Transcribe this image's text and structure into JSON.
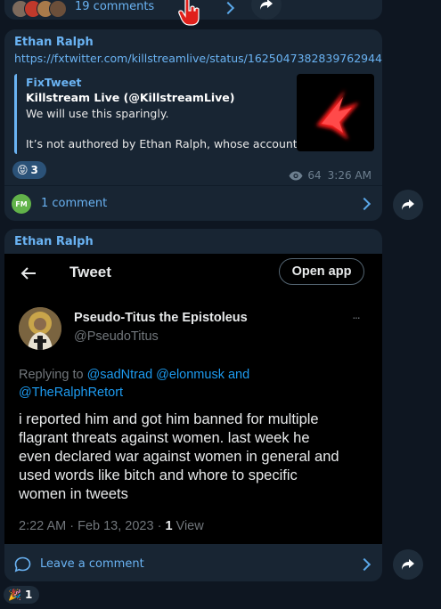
{
  "top_card": {
    "comments_label": "19 comments"
  },
  "post1": {
    "sender": "Ethan Ralph",
    "url": "https://fxtwitter.com/killstreamlive/status/1625047382839762944",
    "preview": {
      "site": "FixTweet",
      "title": "Killstream Live (@KillstreamLive)",
      "line1": "We will use this sparingly.",
      "line2": "It’s not authored by Ethan Ralph, whose account…"
    },
    "reaction": {
      "emoji": "😝",
      "count": "3"
    },
    "views": "64",
    "time": "3:26 AM",
    "comment_avatar": "FM",
    "comment_label": "1 comment"
  },
  "post2": {
    "sender": "Ethan Ralph",
    "tweet": {
      "header_title": "Tweet",
      "open_app": "Open app",
      "author_name": "Pseudo-Titus the Epistoleus",
      "author_handle": "@PseudoTitus",
      "more": "···",
      "replying_prefix": "Replying to ",
      "replying_targets_line1": "@sadNtrad @elonmusk and",
      "replying_targets_line2": "@TheRalphRetort",
      "body_line1": "i reported him and got him banned for multiple",
      "body_line2": "flagrant threats against women. last week he",
      "body_line3": "even declared war against women in general and",
      "body_line4": "used words like bitch and whore to specific",
      "body_line5": "women in tweets",
      "timestamp": "2:22 AM · Feb 13, 2023 · ",
      "view_count": "1",
      "view_label": " View"
    },
    "leave_comment": "Leave a comment",
    "reaction": {
      "emoji": "🎉",
      "count": "1"
    }
  }
}
